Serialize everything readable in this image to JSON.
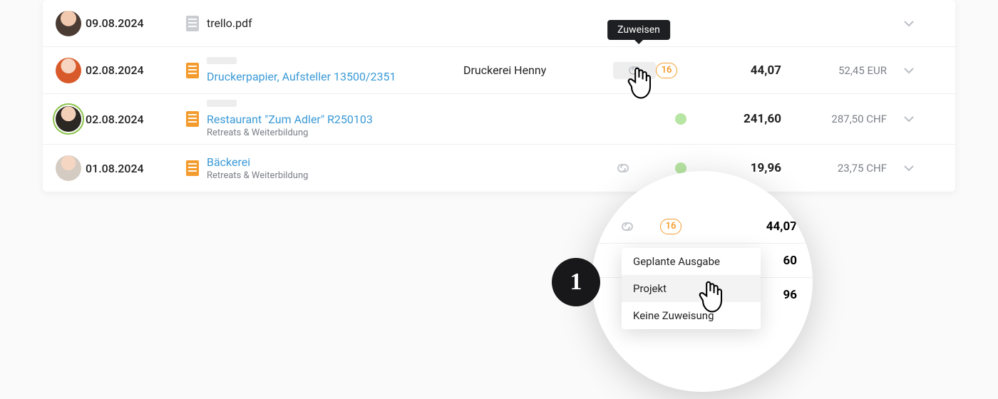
{
  "tooltip": {
    "label": "Zuweisen"
  },
  "step_number": "1",
  "rows": [
    {
      "date": "09.08.2024",
      "title": "trello.pdf",
      "title_is_link": false,
      "subtitle": "",
      "vendor": "",
      "receipt_color": "grey",
      "has_prebar": false,
      "link_state": "none",
      "badge": "",
      "dot": false,
      "amount": "",
      "total": "",
      "avatar_ring": false
    },
    {
      "date": "02.08.2024",
      "title": "Druckerpapier, Aufsteller 13500/2351",
      "title_is_link": true,
      "subtitle": "",
      "vendor": "Druckerei Henny",
      "receipt_color": "orange",
      "has_prebar": true,
      "link_state": "active",
      "badge": "16",
      "dot": false,
      "amount": "44,07",
      "total": "52,45 EUR",
      "avatar_ring": false
    },
    {
      "date": "02.08.2024",
      "title": "Restaurant \"Zum Adler\" R250103",
      "title_is_link": true,
      "subtitle": "Retreats & Weiterbildung",
      "vendor": "",
      "receipt_color": "orange",
      "has_prebar": true,
      "link_state": "none",
      "badge": "",
      "dot": true,
      "amount": "241,60",
      "total": "287,50 CHF",
      "avatar_ring": true
    },
    {
      "date": "01.08.2024",
      "title": "Bäckerei",
      "title_is_link": true,
      "subtitle": "Retreats & Weiterbildung",
      "vendor": "",
      "receipt_color": "orange",
      "has_prebar": false,
      "link_state": "idle",
      "badge": "",
      "dot": true,
      "amount": "19,96",
      "total": "23,75 CHF",
      "avatar_ring": false
    }
  ],
  "lens": {
    "rows": [
      {
        "badge": "16",
        "amount": "44,07",
        "link_state": "idle"
      },
      {
        "dot": true,
        "amount": "60",
        "noamount_full": true
      },
      {
        "dot": true,
        "amount": "96",
        "noamount_full": true
      }
    ],
    "dropdown": {
      "items": [
        {
          "label": "Geplante Ausgabe"
        },
        {
          "label": "Projekt",
          "hovered": true
        },
        {
          "label": "Keine Zuweisung"
        }
      ]
    }
  }
}
